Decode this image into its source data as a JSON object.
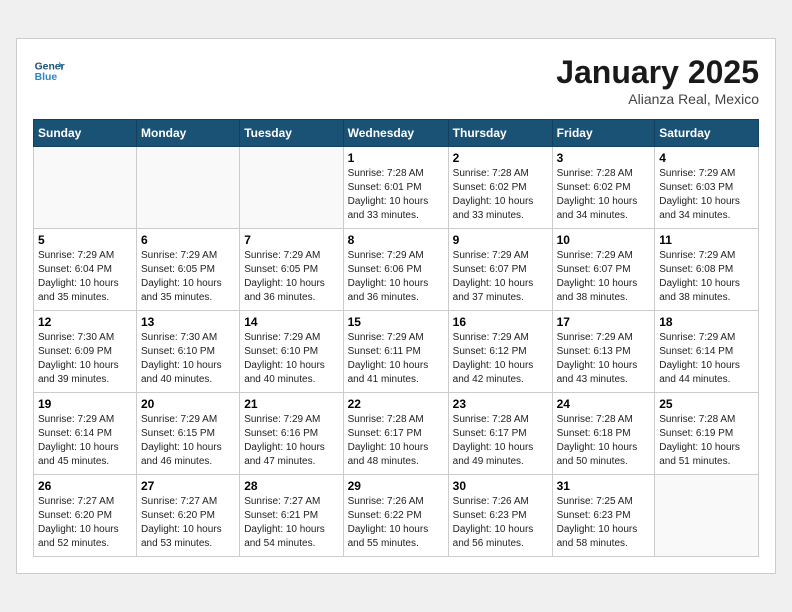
{
  "header": {
    "logo_line1": "General",
    "logo_line2": "Blue",
    "month_title": "January 2025",
    "subtitle": "Alianza Real, Mexico"
  },
  "days_of_week": [
    "Sunday",
    "Monday",
    "Tuesday",
    "Wednesday",
    "Thursday",
    "Friday",
    "Saturday"
  ],
  "weeks": [
    [
      {
        "day": "",
        "info": ""
      },
      {
        "day": "",
        "info": ""
      },
      {
        "day": "",
        "info": ""
      },
      {
        "day": "1",
        "info": "Sunrise: 7:28 AM\nSunset: 6:01 PM\nDaylight: 10 hours\nand 33 minutes."
      },
      {
        "day": "2",
        "info": "Sunrise: 7:28 AM\nSunset: 6:02 PM\nDaylight: 10 hours\nand 33 minutes."
      },
      {
        "day": "3",
        "info": "Sunrise: 7:28 AM\nSunset: 6:02 PM\nDaylight: 10 hours\nand 34 minutes."
      },
      {
        "day": "4",
        "info": "Sunrise: 7:29 AM\nSunset: 6:03 PM\nDaylight: 10 hours\nand 34 minutes."
      }
    ],
    [
      {
        "day": "5",
        "info": "Sunrise: 7:29 AM\nSunset: 6:04 PM\nDaylight: 10 hours\nand 35 minutes."
      },
      {
        "day": "6",
        "info": "Sunrise: 7:29 AM\nSunset: 6:05 PM\nDaylight: 10 hours\nand 35 minutes."
      },
      {
        "day": "7",
        "info": "Sunrise: 7:29 AM\nSunset: 6:05 PM\nDaylight: 10 hours\nand 36 minutes."
      },
      {
        "day": "8",
        "info": "Sunrise: 7:29 AM\nSunset: 6:06 PM\nDaylight: 10 hours\nand 36 minutes."
      },
      {
        "day": "9",
        "info": "Sunrise: 7:29 AM\nSunset: 6:07 PM\nDaylight: 10 hours\nand 37 minutes."
      },
      {
        "day": "10",
        "info": "Sunrise: 7:29 AM\nSunset: 6:07 PM\nDaylight: 10 hours\nand 38 minutes."
      },
      {
        "day": "11",
        "info": "Sunrise: 7:29 AM\nSunset: 6:08 PM\nDaylight: 10 hours\nand 38 minutes."
      }
    ],
    [
      {
        "day": "12",
        "info": "Sunrise: 7:30 AM\nSunset: 6:09 PM\nDaylight: 10 hours\nand 39 minutes."
      },
      {
        "day": "13",
        "info": "Sunrise: 7:30 AM\nSunset: 6:10 PM\nDaylight: 10 hours\nand 40 minutes."
      },
      {
        "day": "14",
        "info": "Sunrise: 7:29 AM\nSunset: 6:10 PM\nDaylight: 10 hours\nand 40 minutes."
      },
      {
        "day": "15",
        "info": "Sunrise: 7:29 AM\nSunset: 6:11 PM\nDaylight: 10 hours\nand 41 minutes."
      },
      {
        "day": "16",
        "info": "Sunrise: 7:29 AM\nSunset: 6:12 PM\nDaylight: 10 hours\nand 42 minutes."
      },
      {
        "day": "17",
        "info": "Sunrise: 7:29 AM\nSunset: 6:13 PM\nDaylight: 10 hours\nand 43 minutes."
      },
      {
        "day": "18",
        "info": "Sunrise: 7:29 AM\nSunset: 6:14 PM\nDaylight: 10 hours\nand 44 minutes."
      }
    ],
    [
      {
        "day": "19",
        "info": "Sunrise: 7:29 AM\nSunset: 6:14 PM\nDaylight: 10 hours\nand 45 minutes."
      },
      {
        "day": "20",
        "info": "Sunrise: 7:29 AM\nSunset: 6:15 PM\nDaylight: 10 hours\nand 46 minutes."
      },
      {
        "day": "21",
        "info": "Sunrise: 7:29 AM\nSunset: 6:16 PM\nDaylight: 10 hours\nand 47 minutes."
      },
      {
        "day": "22",
        "info": "Sunrise: 7:28 AM\nSunset: 6:17 PM\nDaylight: 10 hours\nand 48 minutes."
      },
      {
        "day": "23",
        "info": "Sunrise: 7:28 AM\nSunset: 6:17 PM\nDaylight: 10 hours\nand 49 minutes."
      },
      {
        "day": "24",
        "info": "Sunrise: 7:28 AM\nSunset: 6:18 PM\nDaylight: 10 hours\nand 50 minutes."
      },
      {
        "day": "25",
        "info": "Sunrise: 7:28 AM\nSunset: 6:19 PM\nDaylight: 10 hours\nand 51 minutes."
      }
    ],
    [
      {
        "day": "26",
        "info": "Sunrise: 7:27 AM\nSunset: 6:20 PM\nDaylight: 10 hours\nand 52 minutes."
      },
      {
        "day": "27",
        "info": "Sunrise: 7:27 AM\nSunset: 6:20 PM\nDaylight: 10 hours\nand 53 minutes."
      },
      {
        "day": "28",
        "info": "Sunrise: 7:27 AM\nSunset: 6:21 PM\nDaylight: 10 hours\nand 54 minutes."
      },
      {
        "day": "29",
        "info": "Sunrise: 7:26 AM\nSunset: 6:22 PM\nDaylight: 10 hours\nand 55 minutes."
      },
      {
        "day": "30",
        "info": "Sunrise: 7:26 AM\nSunset: 6:23 PM\nDaylight: 10 hours\nand 56 minutes."
      },
      {
        "day": "31",
        "info": "Sunrise: 7:25 AM\nSunset: 6:23 PM\nDaylight: 10 hours\nand 58 minutes."
      },
      {
        "day": "",
        "info": ""
      }
    ]
  ]
}
